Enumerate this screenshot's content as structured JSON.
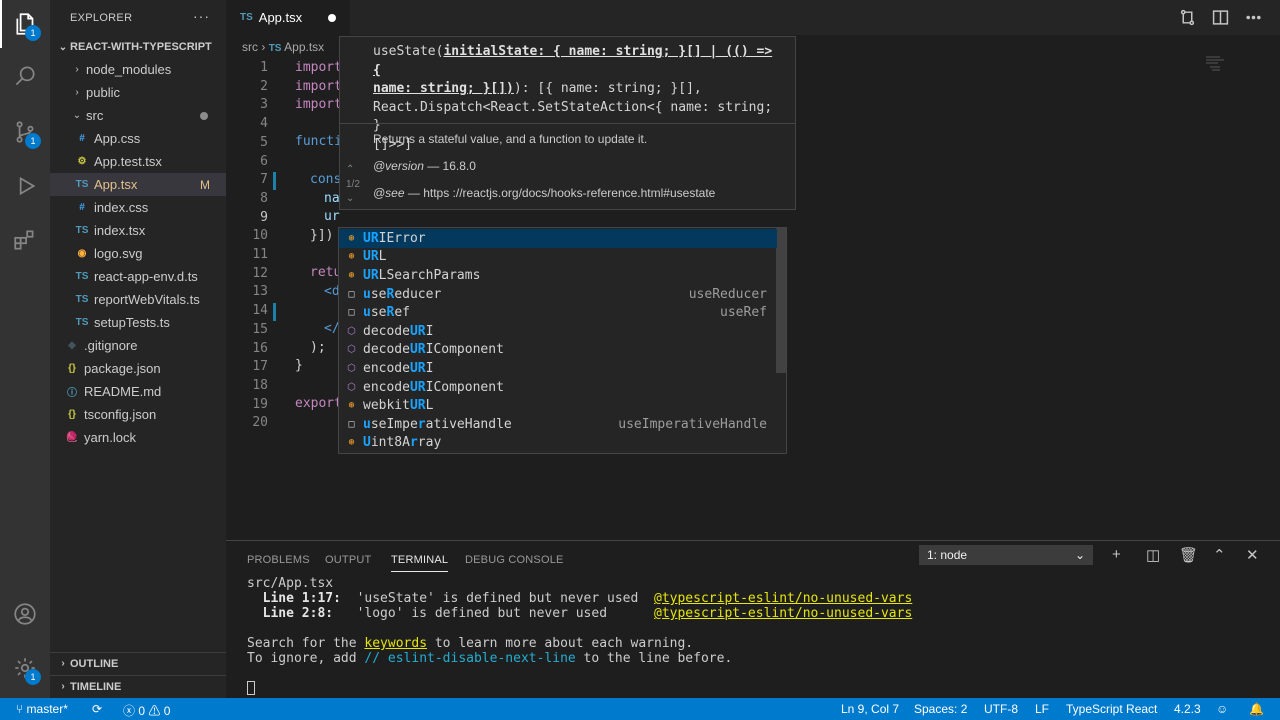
{
  "sidebar": {
    "title": "EXPLORER",
    "more": "···",
    "project": "REACT-WITH-TYPESCRIPT",
    "items": [
      {
        "name": "node_modules",
        "icon": "chevron",
        "ind": 1,
        "color": "#ccc"
      },
      {
        "name": "public",
        "icon": "chevron",
        "ind": 1,
        "color": "#ccc"
      },
      {
        "name": "src",
        "icon": "chevron-open",
        "ind": 1,
        "color": "#ccc",
        "dot": true
      },
      {
        "name": "App.css",
        "icon": "#",
        "ind": 2,
        "iconColor": "#42a5f5"
      },
      {
        "name": "App.test.tsx",
        "icon": "⚙",
        "ind": 2,
        "iconColor": "#cbcb41"
      },
      {
        "name": "App.tsx",
        "icon": "TS",
        "ind": 2,
        "iconColor": "#519aba",
        "selected": true,
        "status": "M",
        "color": "#e2c08d"
      },
      {
        "name": "index.css",
        "icon": "#",
        "ind": 2,
        "iconColor": "#42a5f5"
      },
      {
        "name": "index.tsx",
        "icon": "TS",
        "ind": 2,
        "iconColor": "#519aba"
      },
      {
        "name": "logo.svg",
        "icon": "◉",
        "ind": 2,
        "iconColor": "#ffb13b"
      },
      {
        "name": "react-app-env.d.ts",
        "icon": "TS",
        "ind": 2,
        "iconColor": "#519aba"
      },
      {
        "name": "reportWebVitals.ts",
        "icon": "TS",
        "ind": 2,
        "iconColor": "#519aba"
      },
      {
        "name": "setupTests.ts",
        "icon": "TS",
        "ind": 2,
        "iconColor": "#519aba"
      },
      {
        "name": ".gitignore",
        "icon": "◆",
        "ind": 1,
        "iconColor": "#41535b"
      },
      {
        "name": "package.json",
        "icon": "{}",
        "ind": 1,
        "iconColor": "#cbcb41"
      },
      {
        "name": "README.md",
        "icon": "ⓘ",
        "ind": 1,
        "iconColor": "#519aba"
      },
      {
        "name": "tsconfig.json",
        "icon": "{}",
        "ind": 1,
        "iconColor": "#cbcb41"
      },
      {
        "name": "yarn.lock",
        "icon": "🧶",
        "ind": 1,
        "iconColor": "#3c8ad1"
      }
    ],
    "outline": "OUTLINE",
    "timeline": "TIMELINE"
  },
  "tab": {
    "icon": "TS",
    "label": "App.tsx"
  },
  "breadcrumb": {
    "src": "src",
    "sep": "›",
    "ts": "TS",
    "file": "App.tsx"
  },
  "lines": [
    "1",
    "2",
    "3",
    "4",
    "5",
    "6",
    "7",
    "8",
    "9",
    "10",
    "11",
    "12",
    "13",
    "14",
    "15",
    "16",
    "17",
    "18",
    "19",
    "20"
  ],
  "code": {
    "l1": "import",
    "l2": "import",
    "l3": "import",
    "l5": "functi",
    "l7": "cons",
    "l8": "na",
    "l9": "ur",
    "l10": "}])",
    "l12": "retu",
    "l13": "<d",
    "l15": "</",
    "l16": ");",
    "l17": "}",
    "l19": "export"
  },
  "hover": {
    "sig1": "useState(",
    "sig_param": "initialState: { name: string; }[] | (() => {",
    "sig_param2": "name: string; }[])",
    "sig2": "): [{ name: string; }[],",
    "sig3": "React.Dispatch<React.SetStateAction<{ name: string; }",
    "sig4": "[]>>]",
    "doc": "Returns a stateful value, and a function to update it.",
    "version_tag": "@version",
    "version": " — 16.8.0",
    "see_tag": "@see",
    "see": " — https ://reactjs.org/docs/hooks-reference.html#usestate",
    "overload": "1/2",
    "up": "⌃",
    "down": "⌄"
  },
  "suggest": [
    {
      "pre": "",
      "hl": "UR",
      "post": "IError",
      "kind": "class",
      "sel": true
    },
    {
      "pre": "",
      "hl": "UR",
      "post": "L",
      "kind": "class"
    },
    {
      "pre": "",
      "hl": "UR",
      "post": "LSearchParams",
      "kind": "class"
    },
    {
      "pre": "",
      "hl": "u",
      "post": "se",
      "hl2": "R",
      "post2": "educer",
      "kind": "snippet",
      "detail": "useReducer"
    },
    {
      "pre": "",
      "hl": "u",
      "post": "se",
      "hl2": "R",
      "post2": "ef",
      "kind": "snippet",
      "detail": "useRef"
    },
    {
      "pre": "decode",
      "hl": "UR",
      "post": "I",
      "kind": "method"
    },
    {
      "pre": "decode",
      "hl": "UR",
      "post": "IComponent",
      "kind": "method"
    },
    {
      "pre": "encode",
      "hl": "UR",
      "post": "I",
      "kind": "method"
    },
    {
      "pre": "encode",
      "hl": "UR",
      "post": "IComponent",
      "kind": "method"
    },
    {
      "pre": "webkit",
      "hl": "UR",
      "post": "L",
      "kind": "class"
    },
    {
      "pre": "",
      "hl": "u",
      "post": "seImpe",
      "hl2": "r",
      "post2": "ativeHandle",
      "kind": "snippet",
      "detail": "useImperativeHandle"
    },
    {
      "pre": "",
      "hl": "U",
      "post": "int8A",
      "hl2": "r",
      "post2": "ray",
      "kind": "class"
    }
  ],
  "panel": {
    "tabs": [
      "PROBLEMS",
      "OUTPUT",
      "TERMINAL",
      "DEBUG CONSOLE"
    ],
    "select": "1: node",
    "t1": "src/App.tsx",
    "t2a": "  Line 1:17:",
    "t2b": "  'useState' is defined but never used  ",
    "t2c": "@typescript-eslint/no-unused-vars",
    "t3a": "  Line 2:8:",
    "t3b": "   'logo' is defined but never used      ",
    "t3c": "@typescript-eslint/no-unused-vars",
    "t4a": "Search for the ",
    "t4b": "keywords",
    "t4c": " to learn more about each warning.",
    "t5a": "To ignore, add ",
    "t5b": "// eslint-disable-next-line",
    "t5c": " to the line before."
  },
  "status": {
    "branch": "master*",
    "errors": "0",
    "warnings": "0",
    "pos": "Ln 9, Col 7",
    "spaces": "Spaces: 2",
    "enc": "UTF-8",
    "eol": "LF",
    "lang": "TypeScript React",
    "ver": "4.2.3"
  },
  "badges": {
    "explorer": "1",
    "scm": "1",
    "settings": "1"
  }
}
